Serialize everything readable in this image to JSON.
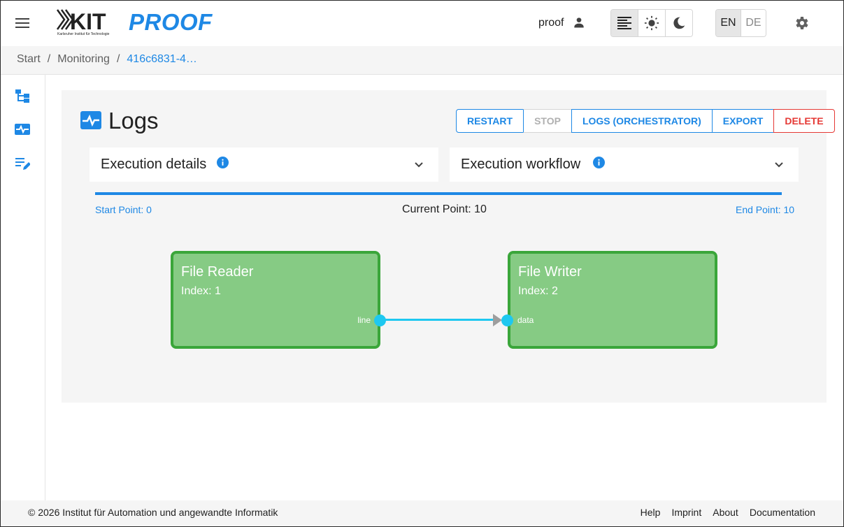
{
  "app": {
    "brand": "PROOF",
    "logo_text": "KIT",
    "logo_subtext": "Karlsruher Institut für Technologie"
  },
  "header": {
    "user_name": "proof",
    "theme_options": [
      "auto-theme",
      "light-theme",
      "dark-theme"
    ],
    "theme_active": "auto-theme",
    "languages": [
      "EN",
      "DE"
    ],
    "language_active": "EN"
  },
  "breadcrumb": {
    "items": [
      "Start",
      "Monitoring",
      "416c6831-4…"
    ],
    "separator": "/"
  },
  "sidebar": {
    "icons": [
      "workflow-icon",
      "monitoring-icon",
      "edit-list-icon"
    ]
  },
  "page": {
    "title": "Logs",
    "buttons": {
      "restart": "RESTART",
      "stop": "STOP",
      "logs_orchestrator": "LOGS (ORCHESTRATOR)",
      "export": "EXPORT",
      "delete": "DELETE"
    },
    "accordions": {
      "execution_details": "Execution details",
      "execution_workflow": "Execution workflow"
    },
    "timeline": {
      "start": "Start Point: 0",
      "current": "Current Point: 10",
      "end": "End Point: 10",
      "progress": 1.0
    }
  },
  "workflow": {
    "nodes": [
      {
        "title": "File Reader",
        "index": "Index: 1",
        "port": "line"
      },
      {
        "title": "File Writer",
        "index": "Index: 2",
        "port": "data"
      }
    ]
  },
  "footer": {
    "copyright": "© 2026 Institut für Automation und angewandte Informatik",
    "links": [
      "Help",
      "Imprint",
      "About",
      "Documentation"
    ]
  },
  "colors": {
    "accent": "#1e88e5",
    "danger": "#e53935",
    "node_fill": "#86cb84",
    "node_border": "#3aa63a",
    "port": "#1ec8f0"
  }
}
